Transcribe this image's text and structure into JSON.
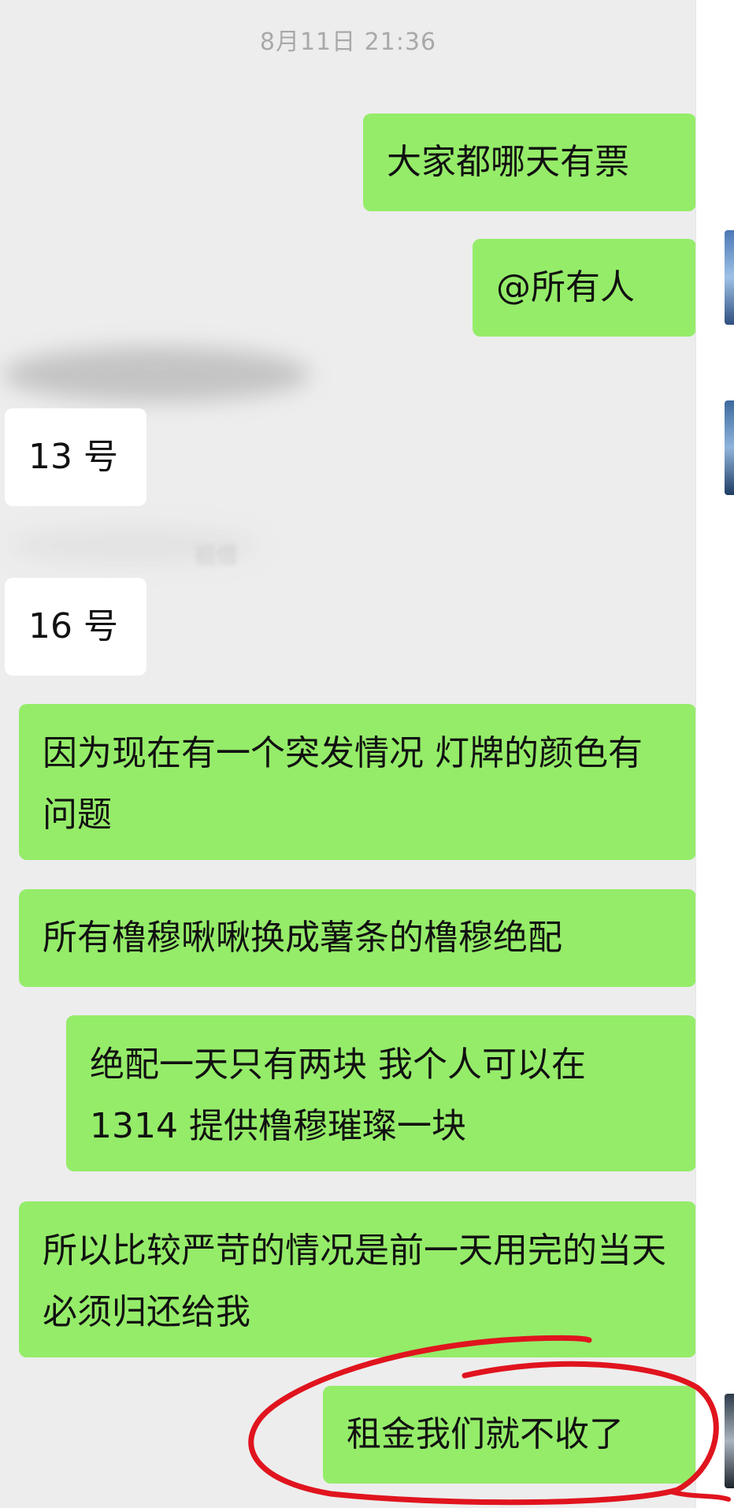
{
  "chat": {
    "timestamp": "8月11日 21:36",
    "messages": [
      {
        "sender": "me",
        "text": "大家都哪天有票"
      },
      {
        "sender": "me",
        "text": "@所有人"
      },
      {
        "sender": "other",
        "text": "13 号"
      },
      {
        "sender": "other",
        "text": "16 号",
        "nickname_fragment": "祖借"
      },
      {
        "sender": "me",
        "text": "因为现在有一个突发情况 灯牌的颜色有问题"
      },
      {
        "sender": "me",
        "text": "所有橹穆啾啾换成薯条的橹穆绝配"
      },
      {
        "sender": "me",
        "text": "绝配一天只有两块 我个人可以在1314 提供橹穆璀璨一块"
      },
      {
        "sender": "me",
        "text": "所以比较严苛的情况是前一天用完的当天必须归还给我"
      },
      {
        "sender": "me",
        "text": "租金我们就不收了"
      }
    ]
  },
  "colors": {
    "background": "#ededed",
    "my_bubble": "#95ec69",
    "other_bubble": "#ffffff",
    "annotation_circle": "#e0141e"
  }
}
